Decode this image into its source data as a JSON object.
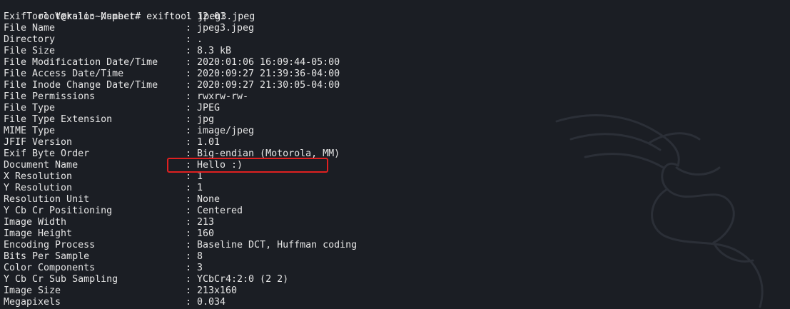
{
  "prompt": {
    "text": "root@kali:~/spect# exiftool jpeg3.jpeg"
  },
  "rows": [
    {
      "key": "ExifTool Version Number",
      "value": "12.01"
    },
    {
      "key": "File Name",
      "value": "jpeg3.jpeg"
    },
    {
      "key": "Directory",
      "value": "."
    },
    {
      "key": "File Size",
      "value": "8.3 kB"
    },
    {
      "key": "File Modification Date/Time",
      "value": "2020:01:06 16:09:44-05:00"
    },
    {
      "key": "File Access Date/Time",
      "value": "2020:09:27 21:39:36-04:00"
    },
    {
      "key": "File Inode Change Date/Time",
      "value": "2020:09:27 21:30:05-04:00"
    },
    {
      "key": "File Permissions",
      "value": "rwxrw-rw-"
    },
    {
      "key": "File Type",
      "value": "JPEG"
    },
    {
      "key": "File Type Extension",
      "value": "jpg"
    },
    {
      "key": "MIME Type",
      "value": "image/jpeg"
    },
    {
      "key": "JFIF Version",
      "value": "1.01"
    },
    {
      "key": "Exif Byte Order",
      "value": "Big-endian (Motorola, MM)"
    },
    {
      "key": "Document Name",
      "value": "Hello :)"
    },
    {
      "key": "X Resolution",
      "value": "1"
    },
    {
      "key": "Y Resolution",
      "value": "1"
    },
    {
      "key": "Resolution Unit",
      "value": "None"
    },
    {
      "key": "Y Cb Cr Positioning",
      "value": "Centered"
    },
    {
      "key": "Image Width",
      "value": "213"
    },
    {
      "key": "Image Height",
      "value": "160"
    },
    {
      "key": "Encoding Process",
      "value": "Baseline DCT, Huffman coding"
    },
    {
      "key": "Bits Per Sample",
      "value": "8"
    },
    {
      "key": "Color Components",
      "value": "3"
    },
    {
      "key": "Y Cb Cr Sub Sampling",
      "value": "YCbCr4:2:0 (2 2)"
    },
    {
      "key": "Image Size",
      "value": "213x160"
    },
    {
      "key": "Megapixels",
      "value": "0.034"
    }
  ],
  "separator": ":",
  "highlight_row_key": "Document Name",
  "colors": {
    "background": "#1b1e24",
    "text": "#e6e6e6",
    "highlight_border": "#e02020"
  },
  "icons": {
    "watermark": "kali-dragon-icon"
  }
}
